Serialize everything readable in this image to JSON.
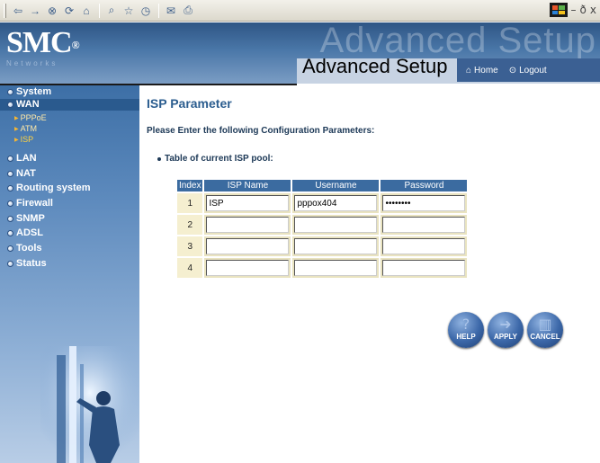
{
  "toolbar": {
    "buttons": [
      "back-icon",
      "forward-icon",
      "stop-icon",
      "refresh-icon",
      "home-icon",
      "search-icon",
      "favorites-icon",
      "history-icon",
      "mail-icon",
      "print-icon"
    ]
  },
  "header": {
    "logo_text": "SMC",
    "logo_reg": "®",
    "logo_sub": "Networks",
    "ghost_title": "Advanced Setup",
    "title": "Advanced Setup",
    "home_label": "Home",
    "logout_label": "Logout"
  },
  "sidebar": {
    "items": [
      {
        "label": "System"
      },
      {
        "label": "WAN",
        "subitems": [
          {
            "label": "PPPoE"
          },
          {
            "label": "ATM"
          },
          {
            "label": "ISP",
            "active": true
          }
        ]
      },
      {
        "label": "LAN"
      },
      {
        "label": "NAT"
      },
      {
        "label": "Routing system"
      },
      {
        "label": "Firewall"
      },
      {
        "label": "SNMP"
      },
      {
        "label": "ADSL"
      },
      {
        "label": "Tools"
      },
      {
        "label": "Status"
      }
    ]
  },
  "main": {
    "title": "ISP Parameter",
    "instructions": "Please Enter the following Configuration Parameters:",
    "pool_label": "Table of current ISP pool:",
    "table": {
      "headers": [
        "Index",
        "ISP Name",
        "Username",
        "Password"
      ],
      "rows": [
        {
          "index": "1",
          "isp_name": "ISP",
          "username": "pppox404",
          "password": "********"
        },
        {
          "index": "2",
          "isp_name": "",
          "username": "",
          "password": ""
        },
        {
          "index": "3",
          "isp_name": "",
          "username": "",
          "password": ""
        },
        {
          "index": "4",
          "isp_name": "",
          "username": "",
          "password": ""
        }
      ]
    },
    "buttons": {
      "help": "HELP",
      "apply": "APPLY",
      "cancel": "CANCEL"
    }
  },
  "colors": {
    "accent": "#2b5d8f",
    "table_header": "#3b6ba0",
    "active_submenu": "#ffd23f"
  }
}
